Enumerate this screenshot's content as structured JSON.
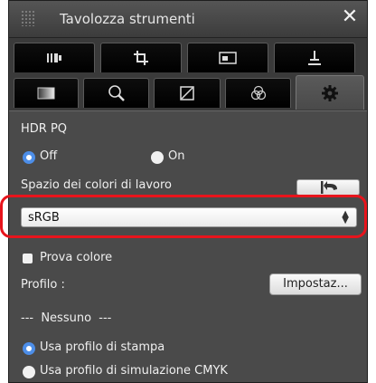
{
  "window": {
    "title": "Tavolozza strumenti",
    "close_glyph": "✕"
  },
  "tabs_row1": [
    "histogram-tool-icon",
    "crop-icon",
    "image-adjust-icon",
    "stamp-icon"
  ],
  "tabs_row2": [
    "picture-style-icon",
    "nr-lens-icon",
    "trim-angle-icon",
    "color-circle-icon",
    "settings-gear-icon"
  ],
  "active_tab": "settings-gear-icon",
  "hdr_pq": {
    "heading": "HDR PQ",
    "off_label": "Off",
    "on_label": "On",
    "selected": "Off"
  },
  "color_space": {
    "label": "Spazio dei colori di lavoro",
    "selected": "sRGB"
  },
  "proof": {
    "label": "Prova colore",
    "profile_label": "Profilo :",
    "settings_button": "Impostaz...",
    "profile_value": "---  Nessuno  ---",
    "option_print": "Usa profilo di stampa",
    "option_cmyk": "Usa profilo di simulazione CMYK"
  },
  "colors": {
    "highlight": "#e8141c",
    "radio_selected": "#4d8ee8"
  }
}
